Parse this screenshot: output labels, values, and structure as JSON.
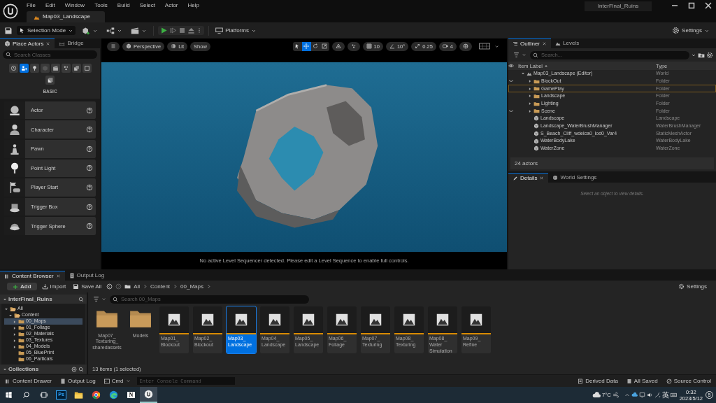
{
  "menu": [
    "File",
    "Edit",
    "Window",
    "Tools",
    "Build",
    "Select",
    "Actor",
    "Help"
  ],
  "document_tab": "Map03_Landscape",
  "project_name": "InterFinal_Ruins",
  "toolbar": {
    "mode": "Selection Mode",
    "platforms": "Platforms",
    "settings": "Settings"
  },
  "place_actors": {
    "tabs": [
      {
        "label": "Place Actors",
        "selected": true
      },
      {
        "label": "Bridge",
        "selected": false
      }
    ],
    "search": {
      "placeholder": "Search Classes"
    },
    "categories": [
      {
        "selected": false
      },
      {
        "selected": true
      },
      {
        "selected": false
      },
      {
        "selected": false
      },
      {
        "selected": false
      },
      {
        "selected": false
      },
      {
        "selected": false
      },
      {
        "selected": false
      },
      {
        "selected": false
      }
    ],
    "section_label": "BASIC",
    "actors": [
      "Actor",
      "Character",
      "Pawn",
      "Point Light",
      "Player Start",
      "Trigger Box",
      "Trigger Sphere"
    ]
  },
  "viewport": {
    "view_mode": "Perspective",
    "lighting": "Lit",
    "show": "Show",
    "transform_tools": [
      {
        "selected": false
      },
      {
        "selected": true
      },
      {
        "selected": false
      },
      {
        "selected": false
      }
    ],
    "grid_snap": "10",
    "rotation_snap": "10°",
    "scale_snap": "0.25",
    "camera_speed": "4",
    "message": "No active Level Sequencer detected. Please edit a Level Sequence to enable full controls."
  },
  "outliner": {
    "tabs": [
      {
        "label": "Outliner",
        "selected": true
      },
      {
        "label": "Levels",
        "selected": false
      }
    ],
    "search": {
      "placeholder": "Search..."
    },
    "columns": [
      "Item Label",
      "Type"
    ],
    "rows": [
      {
        "label": "Map03_Landscape (Editor)",
        "type": "World",
        "kind": "world",
        "expanded": true,
        "hidden": false,
        "selected": false,
        "children": [
          {
            "label": "BlockOut",
            "type": "Folder",
            "kind": "folder",
            "expanded": false,
            "hidden": true,
            "selected": false
          },
          {
            "label": "GamePlay",
            "type": "Folder",
            "kind": "folder",
            "expanded": false,
            "hidden": false,
            "selected": true
          },
          {
            "label": "Landscape",
            "type": "Folder",
            "kind": "folder",
            "expanded": false,
            "hidden": false,
            "selected": false
          },
          {
            "label": "Lighting",
            "type": "Folder",
            "kind": "folder",
            "expanded": false,
            "hidden": false,
            "selected": false
          },
          {
            "label": "Scene",
            "type": "Folder",
            "kind": "folder",
            "expanded": false,
            "hidden": true,
            "selected": false
          },
          {
            "label": "Landscape",
            "type": "Landscape",
            "kind": "actor",
            "hidden": false,
            "selected": false
          },
          {
            "label": "Landscape_WaterBrushManager",
            "type": "WaterBrushManager",
            "kind": "actor",
            "hidden": false,
            "selected": false
          },
          {
            "label": "S_Beach_Cliff_wdelca0_lod0_Var4",
            "type": "StaticMeshActor",
            "kind": "actor",
            "hidden": false,
            "selected": false
          },
          {
            "label": "WaterBodyLake",
            "type": "WaterBodyLake",
            "kind": "actor",
            "hidden": false,
            "selected": false
          },
          {
            "label": "WaterZone",
            "type": "WaterZone",
            "kind": "actor",
            "hidden": false,
            "selected": false
          }
        ]
      }
    ],
    "footer": "24 actors"
  },
  "details": {
    "tabs": [
      {
        "label": "Details",
        "selected": true
      },
      {
        "label": "World Settings",
        "selected": false
      }
    ],
    "empty_message": "Select an object to view details."
  },
  "content_browser": {
    "tabs": [
      {
        "label": "Content Browser",
        "selected": true
      },
      {
        "label": "Output Log",
        "selected": false
      }
    ],
    "buttons": {
      "add": "Add",
      "import": "Import",
      "save_all": "Save All",
      "settings": "Settings"
    },
    "path": [
      "All",
      "Content",
      "00_Maps"
    ],
    "sources_title": "InterFinal_Ruins",
    "tree": [
      {
        "label": "All",
        "expanded": true,
        "has_children": true,
        "selected": false,
        "children": [
          {
            "label": "Content",
            "expanded": true,
            "has_children": true,
            "selected": false,
            "children": [
              {
                "label": "00_Maps",
                "expanded": false,
                "has_children": true,
                "selected": true
              },
              {
                "label": "01_Foliage",
                "expanded": false,
                "has_children": true,
                "selected": false
              },
              {
                "label": "02_Materials",
                "expanded": false,
                "has_children": true,
                "selected": false
              },
              {
                "label": "03_Textures",
                "expanded": false,
                "has_children": true,
                "selected": false
              },
              {
                "label": "04_Models",
                "expanded": false,
                "has_children": true,
                "selected": false
              },
              {
                "label": "05_BluePrint",
                "expanded": false,
                "has_children": false,
                "selected": false
              },
              {
                "label": "06_Particals",
                "expanded": false,
                "has_children": false,
                "selected": false
              }
            ]
          }
        ]
      }
    ],
    "collections_title": "Collections",
    "search": {
      "placeholder": "Search 00_Maps"
    },
    "assets": [
      {
        "label": "Map07_Texturing_sharedassets",
        "kind": "folder",
        "selected": false
      },
      {
        "label": "Models",
        "kind": "folder",
        "selected": false
      },
      {
        "label": "Map01_Blockout",
        "kind": "map",
        "selected": false
      },
      {
        "label": "Map02_Blockout",
        "kind": "map",
        "selected": false
      },
      {
        "label": "Map03_Landscape",
        "kind": "map",
        "selected": true
      },
      {
        "label": "Map04_Landscape",
        "kind": "map",
        "selected": false
      },
      {
        "label": "Map05_Landscape",
        "kind": "map",
        "selected": false
      },
      {
        "label": "Map06_Foliage",
        "kind": "map",
        "selected": false
      },
      {
        "label": "Map07_Texturing",
        "kind": "map",
        "selected": false
      },
      {
        "label": "Map08_Texturing",
        "kind": "map",
        "selected": false
      },
      {
        "label": "Map08_Water Simulation",
        "kind": "map",
        "selected": false
      },
      {
        "label": "Map09_Refine",
        "kind": "map",
        "selected": false
      }
    ],
    "item_count": "13 items (1 selected)"
  },
  "status_bar": {
    "content_drawer": "Content Drawer",
    "output_log": "Output Log",
    "cmd": "Cmd",
    "console": {
      "placeholder": "Enter Console Command"
    },
    "derived_data": "Derived Data",
    "all_saved": "All Saved",
    "source_control": "Source Control"
  },
  "taskbar": {
    "apps": [
      {
        "kind": "start",
        "active": false
      },
      {
        "kind": "search",
        "active": false
      },
      {
        "kind": "task-view",
        "active": false
      },
      {
        "kind": "photoshop",
        "label": "Ps",
        "active": false
      },
      {
        "kind": "files",
        "active": false
      },
      {
        "kind": "chrome",
        "active": false
      },
      {
        "kind": "edge",
        "active": false
      },
      {
        "kind": "notion",
        "label": "N",
        "active": false
      },
      {
        "kind": "unreal",
        "active": true
      }
    ],
    "weather": "7°C",
    "ime": "英",
    "time": "0:32",
    "date": "2023/5/12",
    "notifications": "5"
  }
}
